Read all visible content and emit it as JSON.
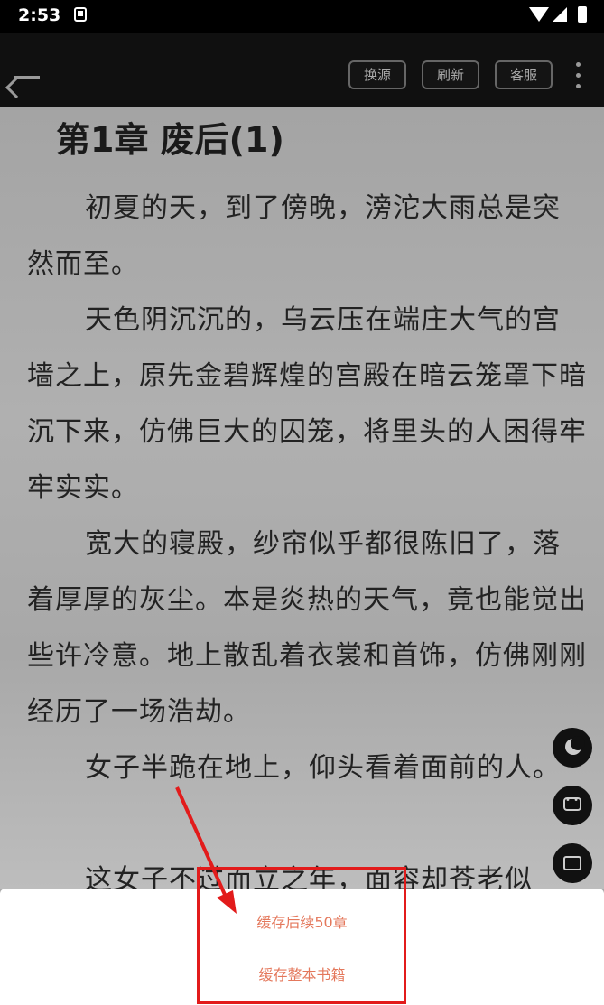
{
  "status_bar": {
    "time": "2:53"
  },
  "toolbar": {
    "buttons": [
      "换源",
      "刷新",
      "客服"
    ]
  },
  "reader": {
    "chapter_title": "第1章 废后(1)",
    "paragraphs": [
      "初夏的天，到了傍晚，滂沱大雨总是突然而至。",
      "天色阴沉沉的，乌云压在端庄大气的宫墙之上，原先金碧辉煌的宫殿在暗云笼罩下暗沉下来，仿佛巨大的囚笼，将里头的人困得牢牢实实。",
      "宽大的寝殿，纱帘似乎都很陈旧了，落着厚厚的灰尘。本是炎热的天气，竟也能觉出些许冷意。地上散乱着衣裳和首饰，仿佛刚刚经历了一场浩劫。",
      "女子半跪在地上，仰头看着面前的人。",
      "这女子不过而立之年，面容却苍老似"
    ]
  },
  "floating_buttons": [
    "moon-icon",
    "chat-icon",
    "screen-icon"
  ],
  "bottom_sheet": {
    "option_1": "缓存后续50章",
    "option_2": "缓存整本书籍"
  },
  "colors": {
    "accent": "#e4785c",
    "annotation": "#e21b1b",
    "toolbar_bg": "#101010"
  }
}
